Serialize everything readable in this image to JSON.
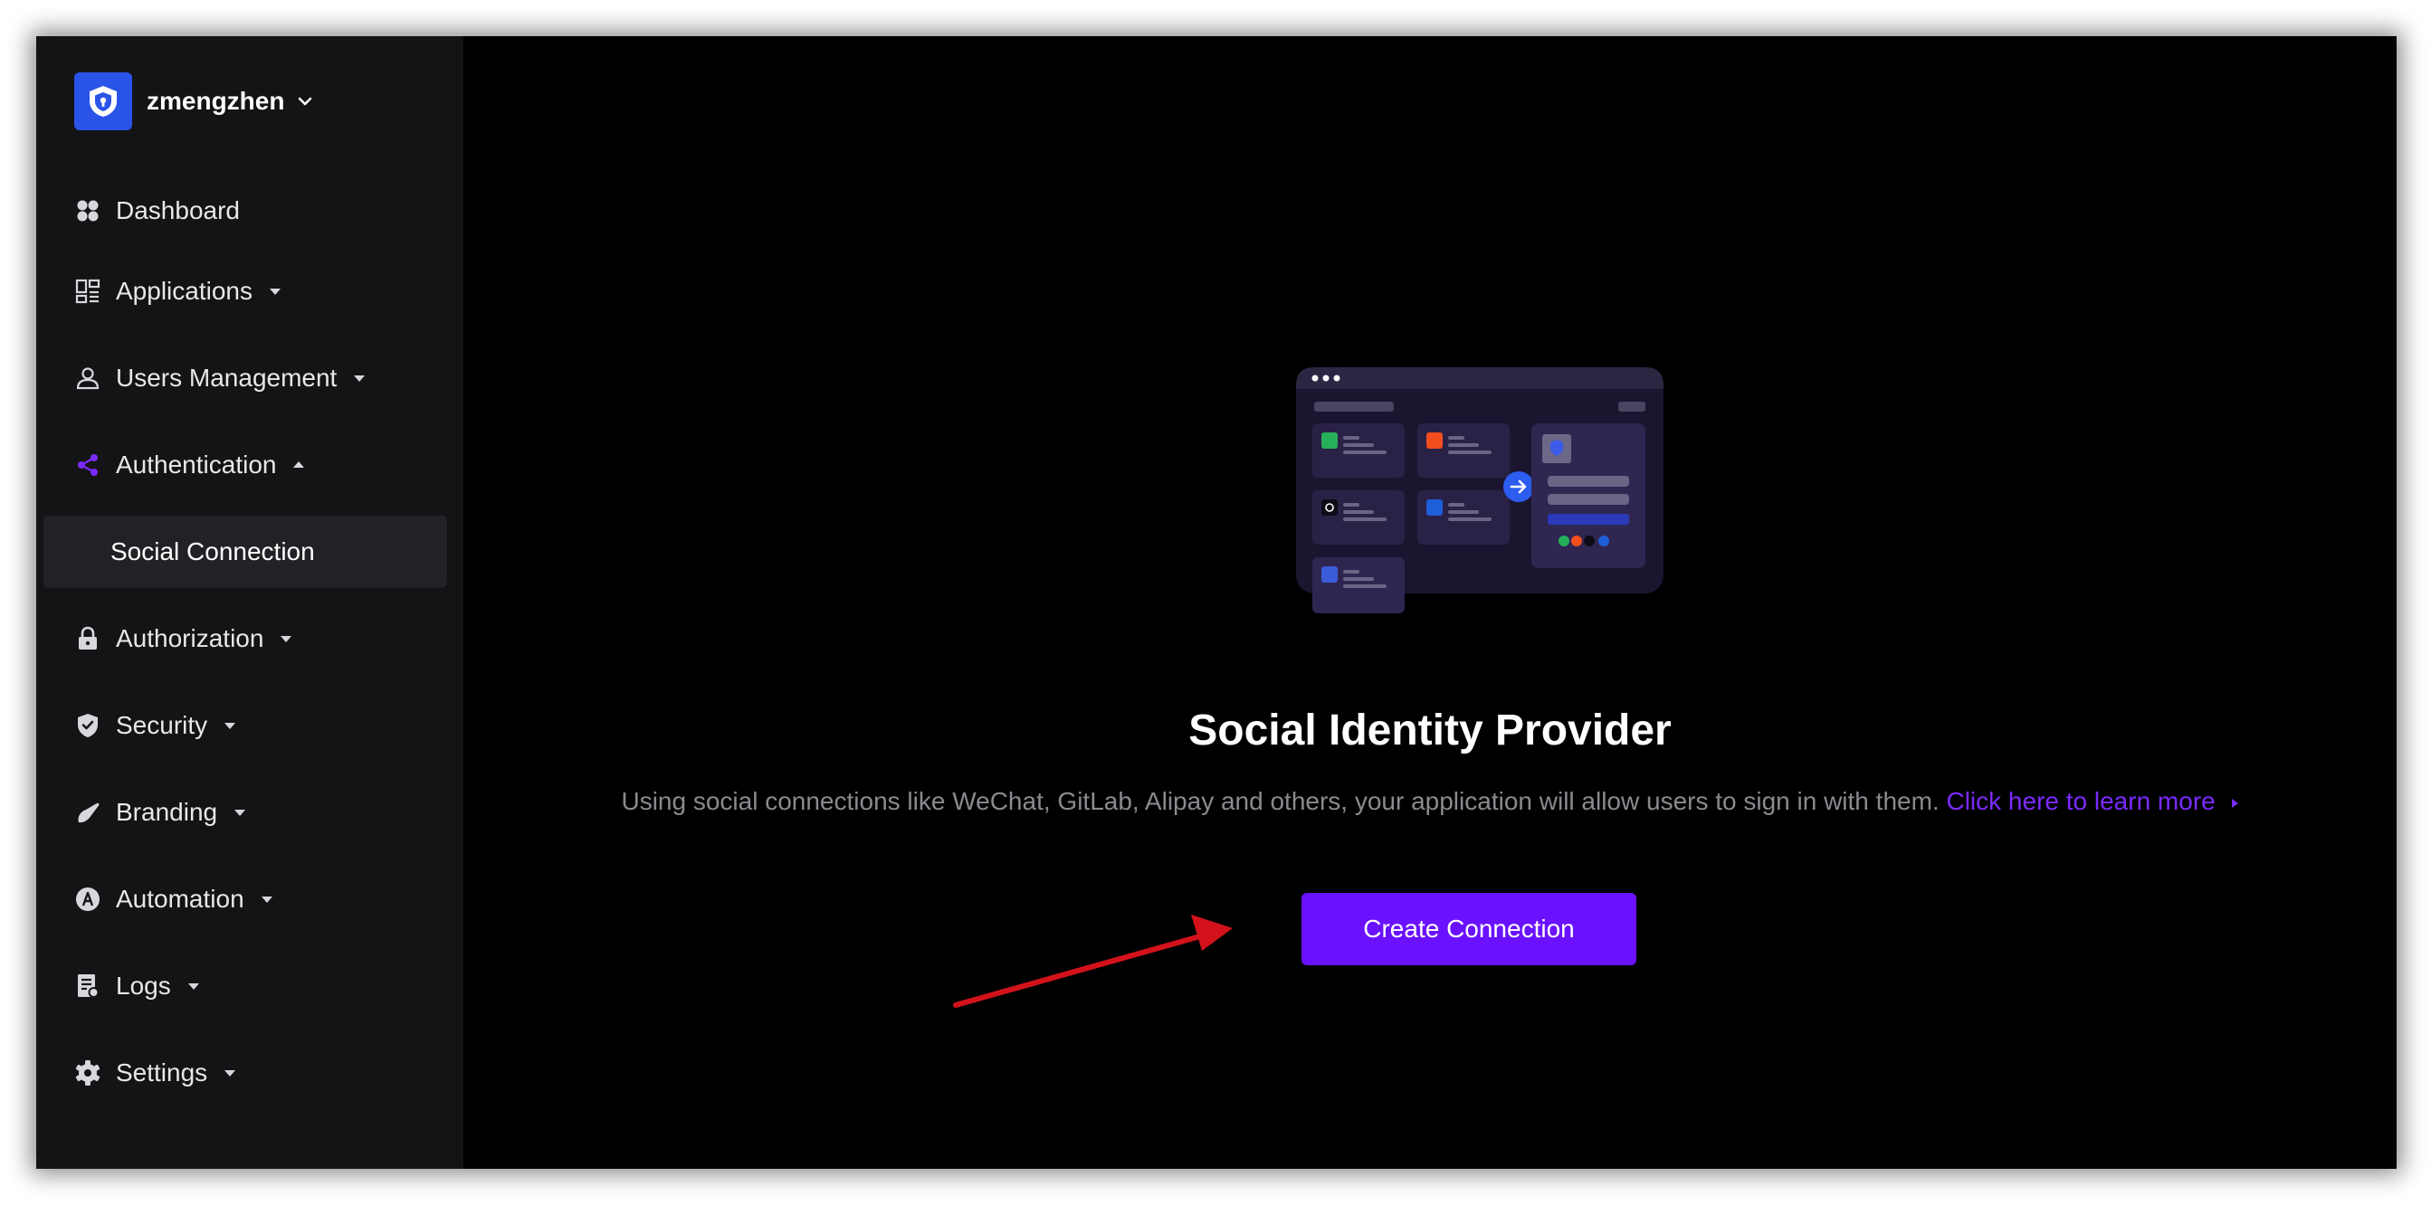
{
  "org": {
    "name": "zmengzhen",
    "logo_icon": "shield-icon",
    "brand_color": "#2a54e8"
  },
  "sidebar": {
    "items": [
      {
        "label": "Dashboard",
        "icon": "dashboard-icon",
        "caret": "none"
      },
      {
        "label": "Applications",
        "icon": "applications-icon",
        "caret": "down"
      },
      {
        "label": "Users Management",
        "icon": "user-icon",
        "caret": "down"
      },
      {
        "label": "Authentication",
        "icon": "share-icon",
        "caret": "up",
        "active": true
      },
      {
        "label": "Authorization",
        "icon": "lock-icon",
        "caret": "down"
      },
      {
        "label": "Security",
        "icon": "shield-icon",
        "caret": "down"
      },
      {
        "label": "Branding",
        "icon": "brush-icon",
        "caret": "down"
      },
      {
        "label": "Automation",
        "icon": "automation-icon",
        "caret": "down"
      },
      {
        "label": "Logs",
        "icon": "logs-icon",
        "caret": "down"
      },
      {
        "label": "Settings",
        "icon": "gear-icon",
        "caret": "down"
      }
    ],
    "sub_item": {
      "label": "Social Connection"
    }
  },
  "main": {
    "title": "Social Identity Provider",
    "description": "Using social connections like WeChat, GitLab, Alipay and others, your application will allow users to sign in with them.",
    "link_text": "Click here to learn more",
    "create_button": "Create Connection"
  },
  "colors": {
    "accent": "#6a12ff",
    "link": "#7b2bff",
    "sidebar_bg": "#141416",
    "main_bg": "#000000",
    "annotation_arrow": "#d3121b"
  }
}
